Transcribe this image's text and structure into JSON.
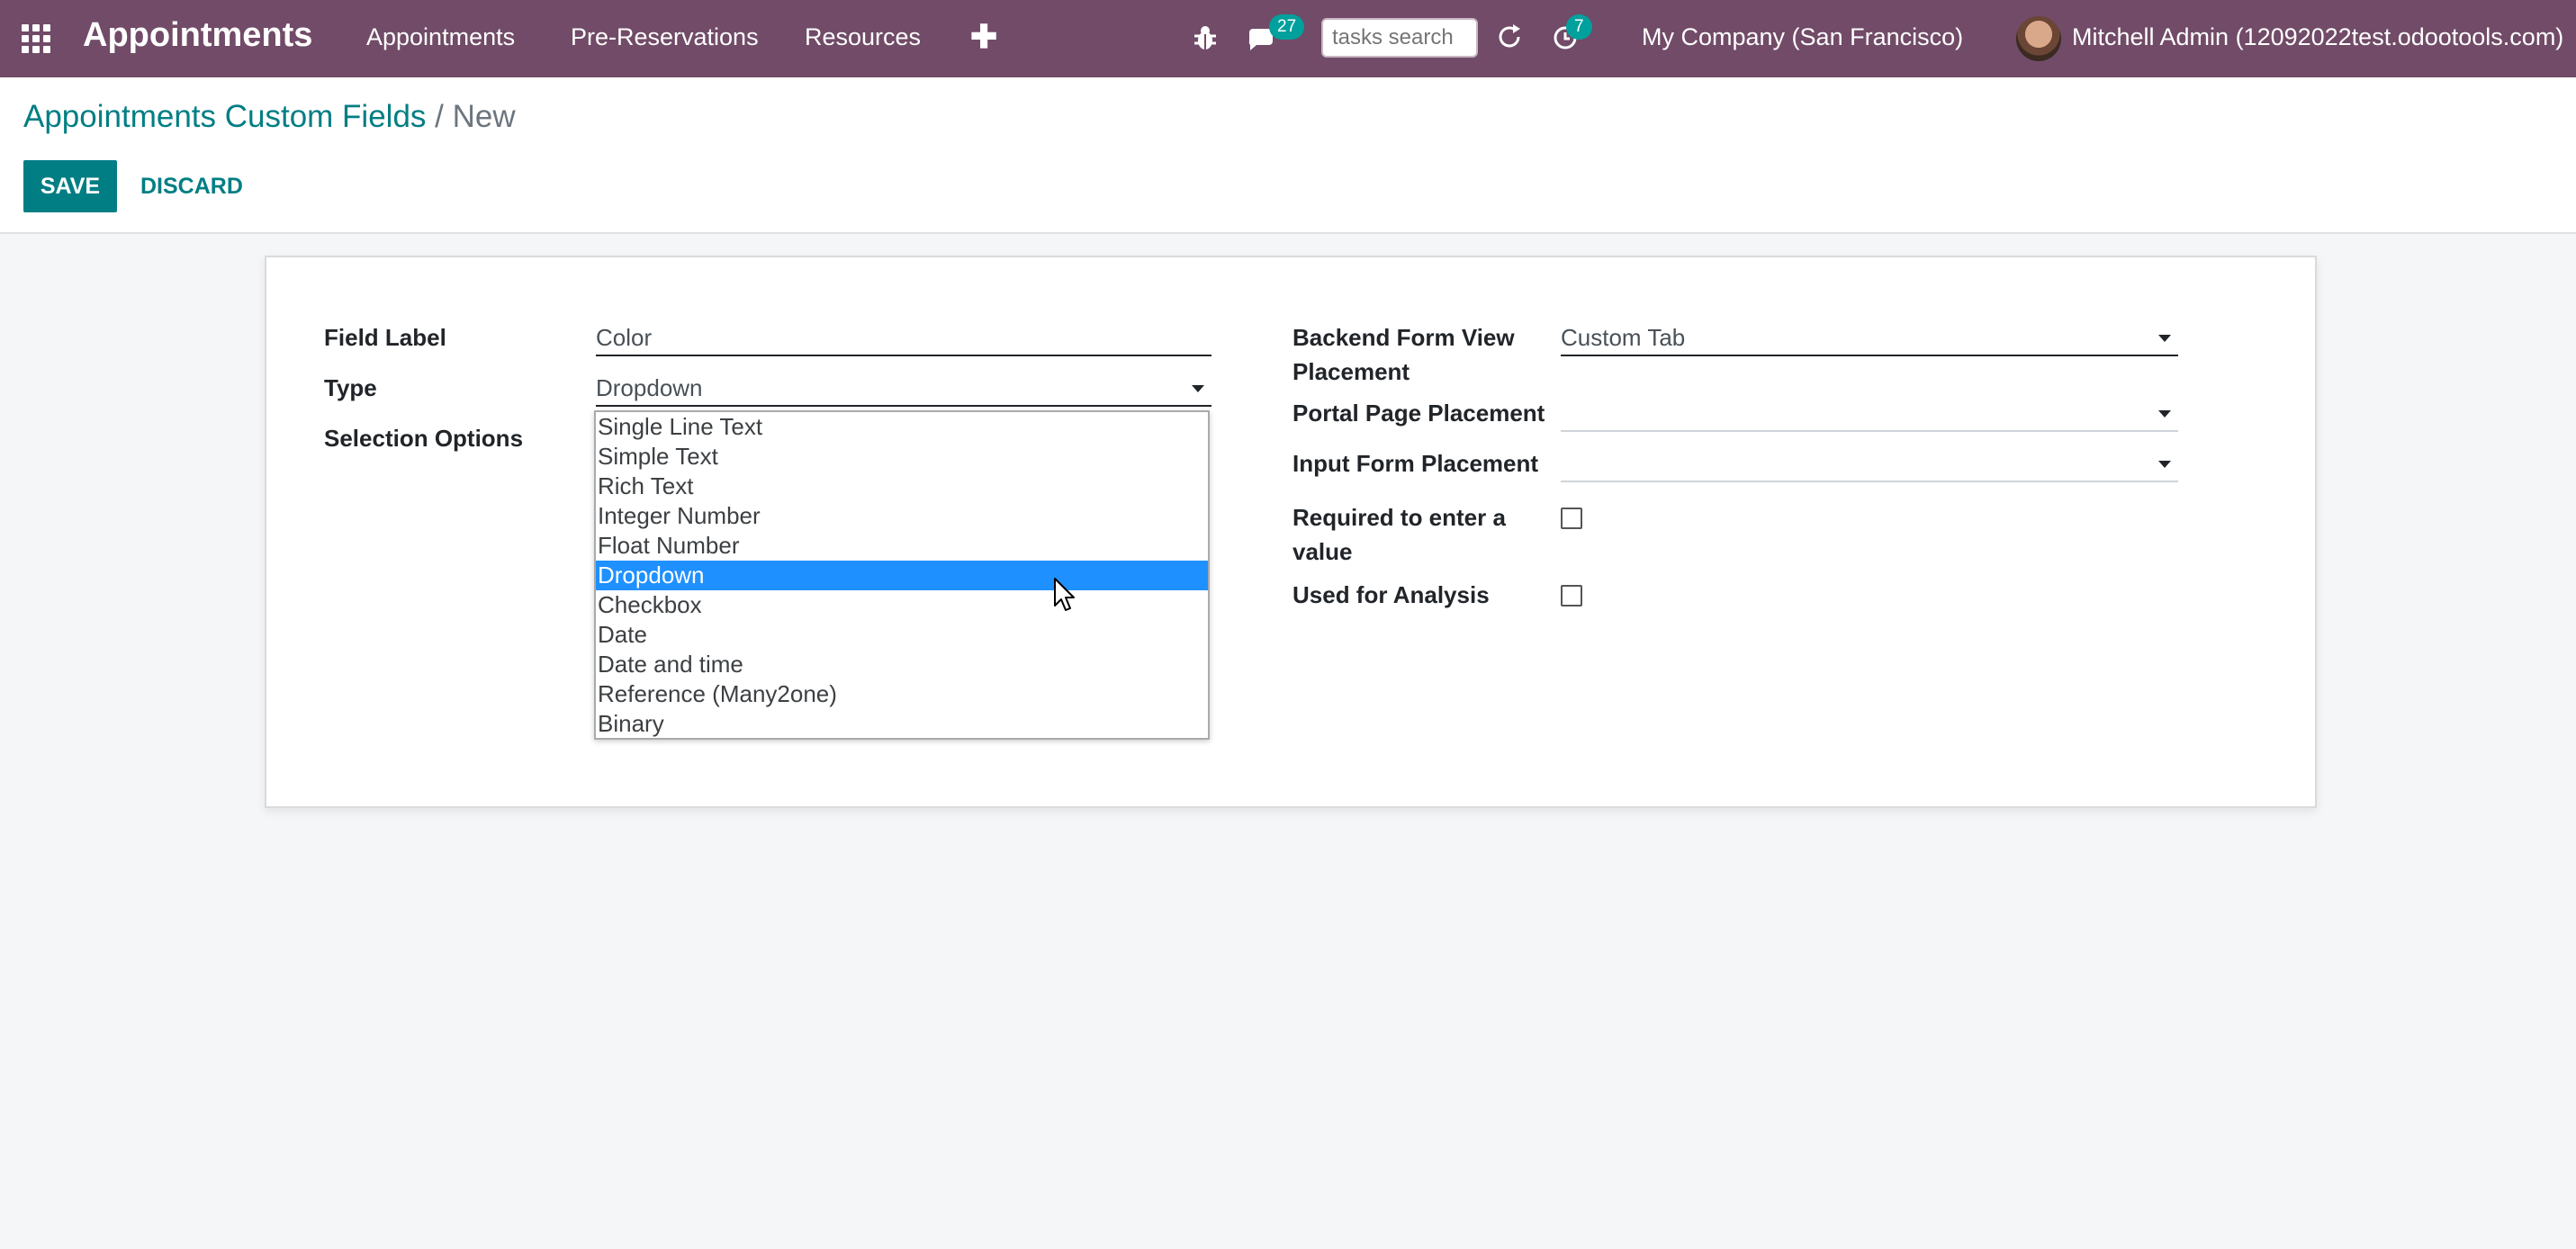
{
  "navbar": {
    "brand": "Appointments",
    "menu": [
      "Appointments",
      "Pre-Reservations",
      "Resources"
    ],
    "plus": "✚",
    "chat_badge": "27",
    "search_placeholder": "tasks search",
    "activity_badge": "7",
    "company": "My Company (San Francisco)",
    "user": "Mitchell Admin (12092022test.odootools.com)",
    "bg_color": "#714b67"
  },
  "control_panel": {
    "breadcrumb_parent": "Appointments Custom Fields",
    "breadcrumb_sep": "/",
    "breadcrumb_current": "New",
    "save_label": "SAVE",
    "discard_label": "DISCARD",
    "accent_color": "#017e84"
  },
  "form": {
    "left": {
      "field_label_label": "Field Label",
      "field_label_value": "Color",
      "type_label": "Type",
      "type_value": "Dropdown",
      "selection_options_label": "Selection Options"
    },
    "right": {
      "backend_placement_label_line1": "Backend Form View",
      "backend_placement_label_line2": "Placement",
      "backend_placement_value": "Custom Tab",
      "portal_placement_label": "Portal Page Placement",
      "portal_placement_value": "",
      "input_placement_label": "Input Form Placement",
      "input_placement_value": "",
      "required_label_line1": "Required to enter a",
      "required_label_line2": "value",
      "required_checked": false,
      "analysis_label": "Used for Analysis",
      "analysis_checked": false
    }
  },
  "type_dropdown": {
    "options": [
      "Single Line Text",
      "Simple Text",
      "Rich Text",
      "Integer Number",
      "Float Number",
      "Dropdown",
      "Checkbox",
      "Date",
      "Date and time",
      "Reference (Many2one)",
      "Binary"
    ],
    "selected": "Dropdown",
    "highlight_color": "#1e90ff"
  }
}
